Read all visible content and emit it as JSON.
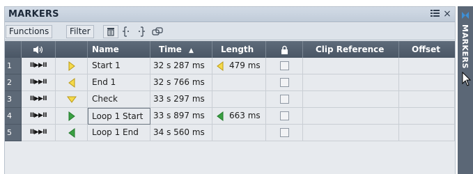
{
  "panel": {
    "title": "MARKERS",
    "titlebar_icons": [
      "panel-layout-icon",
      "close-icon"
    ],
    "close_label": "×"
  },
  "toolbar": {
    "functions_label": "Functions",
    "filter_label": "Filter",
    "tools": [
      "delete-marker-icon",
      "select-start-icon",
      "select-end-icon",
      "loop-link-icon"
    ]
  },
  "columns": {
    "play": "",
    "name": "Name",
    "time": "Time",
    "time_sort": "▲",
    "length": "Length",
    "lock": "",
    "clip_reference": "Clip Reference",
    "offset": "Offset"
  },
  "rows": [
    {
      "num": "1",
      "transport": "II▶▶II",
      "marker": "start",
      "name": "Start 1",
      "time": "32 s 287 ms",
      "length_marker": "end",
      "length": "479 ms",
      "locked": false
    },
    {
      "num": "2",
      "transport": "II▶▶II",
      "marker": "end",
      "name": "End 1",
      "time": "32 s 766 ms",
      "length_marker": "",
      "length": "",
      "locked": false
    },
    {
      "num": "3",
      "transport": "II▶▶II",
      "marker": "generic",
      "name": "Check",
      "time": "33 s 297 ms",
      "length_marker": "",
      "length": "",
      "locked": false
    },
    {
      "num": "4",
      "transport": "II▶▶II",
      "marker": "loop-start",
      "name": "Loop 1 Start",
      "time": "33 s 897 ms",
      "length_marker": "loop-end",
      "length": "663 ms",
      "locked": false
    },
    {
      "num": "5",
      "transport": "II▶▶II",
      "marker": "loop-end",
      "name": "Loop 1 End",
      "time": "34 s 560 ms",
      "length_marker": "",
      "length": "",
      "locked": false
    }
  ],
  "side_tab": {
    "label": "MARKERS",
    "icon": "pin-icon"
  },
  "colors": {
    "start_marker": "#f5d94a",
    "loop_marker": "#3aa043",
    "header_bg": "#4f5b6a"
  }
}
